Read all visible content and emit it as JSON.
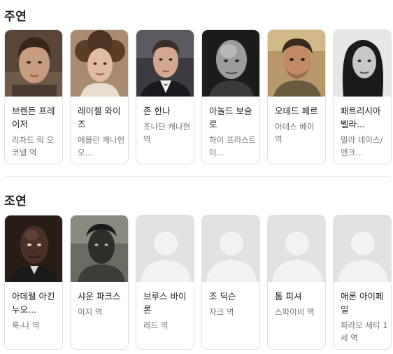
{
  "sections": {
    "main": {
      "title": "주연",
      "cast": [
        {
          "name": "브렌든 프레이저",
          "role": "리차드 릭 오코넬 역",
          "photo": "portrait-brown-hair",
          "bg": "#8a6a52"
        },
        {
          "name": "레이첼 와이즈",
          "role": "에블린 캐나헌 오...",
          "photo": "portrait-curly-hair",
          "bg": "#b9a28a"
        },
        {
          "name": "존 한나",
          "role": "조나단 캐나헌 역",
          "photo": "portrait-tuxedo",
          "bg": "#4b4b4b"
        },
        {
          "name": "아놀드 보슬로",
          "role": "하이 프리스트 이...",
          "photo": "portrait-bald-bw",
          "bg": "#2a2a2a"
        },
        {
          "name": "오데드 페르",
          "role": "아데스 베이 역",
          "photo": "portrait-stubble",
          "bg": "#9a7050"
        },
        {
          "name": "패트리시아 벨라...",
          "role": "밀라 네이스/앤크...",
          "photo": "portrait-dark-hair-bw",
          "bg": "#e8e8e8"
        }
      ]
    },
    "supporting": {
      "title": "조연",
      "cast": [
        {
          "name": "아데웰 아킨누오...",
          "role": "룩-나 역",
          "photo": "portrait-bald-dark",
          "bg": "#3a2a22"
        },
        {
          "name": "샤운 파크스",
          "role": "이지 역",
          "photo": "portrait-bw-outdoor",
          "bg": "#5a5a52"
        },
        {
          "name": "브루스 바이론",
          "role": "레드 역",
          "photo": "placeholder",
          "bg": "#e1e1e1"
        },
        {
          "name": "조 딕슨",
          "role": "자크 역",
          "photo": "placeholder",
          "bg": "#e1e1e1"
        },
        {
          "name": "톰 피셔",
          "role": "스파이비 역",
          "photo": "placeholder",
          "bg": "#e1e1e1"
        },
        {
          "name": "애론 아이페일",
          "role": "파라오 세티 1세 역",
          "photo": "placeholder",
          "bg": "#e1e1e1"
        }
      ]
    }
  },
  "colors": {
    "text": "#202124",
    "secondary_text": "#70757a",
    "card_border": "#e2e2e2",
    "placeholder_bg": "#e1e1e1",
    "placeholder_figure": "#f2f2f2"
  }
}
